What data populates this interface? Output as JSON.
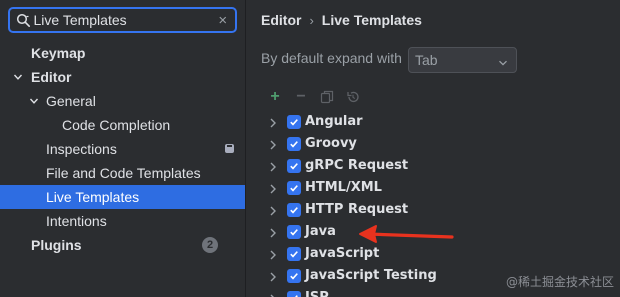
{
  "search": {
    "value": "Live Templates"
  },
  "sidebar": {
    "items": [
      {
        "label": "Keymap"
      },
      {
        "label": "Editor"
      },
      {
        "label": "General"
      },
      {
        "label": "Code Completion"
      },
      {
        "label": "Inspections"
      },
      {
        "label": "File and Code Templates"
      },
      {
        "label": "Live Templates"
      },
      {
        "label": "Intentions"
      },
      {
        "label": "Plugins",
        "badge": "2"
      }
    ]
  },
  "breadcrumb": {
    "parent": "Editor",
    "separator": "›",
    "current": "Live Templates"
  },
  "expand": {
    "label": "By default expand with",
    "value": "Tab"
  },
  "toolbar": {
    "add": "+",
    "remove": "−"
  },
  "groups": [
    {
      "label": "Angular",
      "checked": true
    },
    {
      "label": "Groovy",
      "checked": true
    },
    {
      "label": "gRPC Request",
      "checked": true
    },
    {
      "label": "HTML/XML",
      "checked": true
    },
    {
      "label": "HTTP Request",
      "checked": true
    },
    {
      "label": "Java",
      "checked": true
    },
    {
      "label": "JavaScript",
      "checked": true
    },
    {
      "label": "JavaScript Testing",
      "checked": true
    },
    {
      "label": "JSP",
      "checked": true
    }
  ],
  "watermark": "@稀土掘金技术社区",
  "colors": {
    "accent": "#3574f0",
    "selection": "#2e6de2",
    "arrow": "#e8321e",
    "add": "#4f9d6e"
  }
}
